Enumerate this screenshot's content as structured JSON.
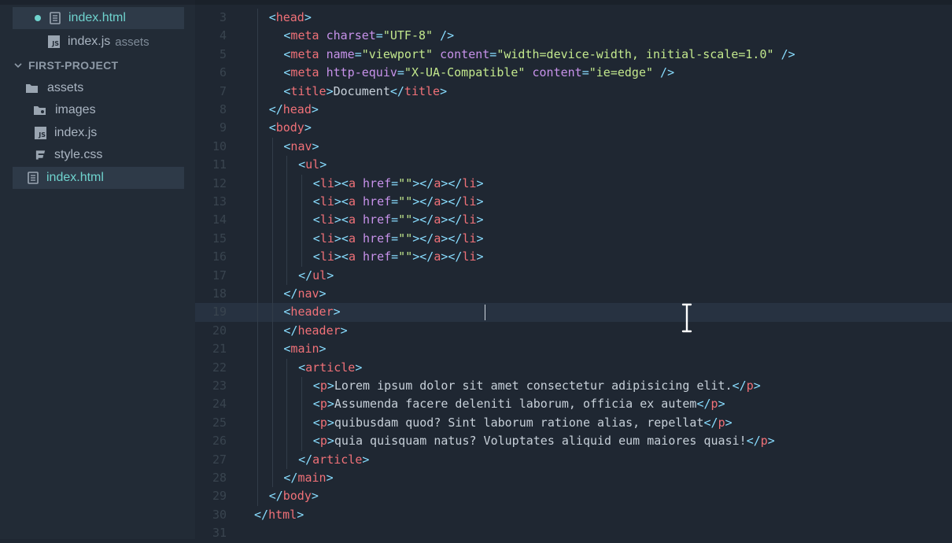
{
  "sidebar": {
    "open_file": {
      "label": "index.html"
    },
    "open_file_2": {
      "label": "index.js",
      "hint": "assets"
    },
    "project": {
      "label": "FIRST-PROJECT"
    },
    "folder": {
      "label": "assets"
    },
    "items": [
      {
        "label": "images"
      },
      {
        "label": "index.js"
      },
      {
        "label": "style.css"
      }
    ],
    "selected_file": {
      "label": "index.html"
    }
  },
  "editor": {
    "current_line": 19,
    "lines": [
      {
        "num": "3",
        "indent": 1,
        "tokens": [
          [
            "br",
            "<"
          ],
          [
            "tag",
            "head"
          ],
          [
            "br",
            ">"
          ]
        ]
      },
      {
        "num": "4",
        "indent": 2,
        "tokens": [
          [
            "br",
            "<"
          ],
          [
            "tag",
            "meta"
          ],
          [
            "txt",
            " "
          ],
          [
            "attr",
            "charset"
          ],
          [
            "op",
            "="
          ],
          [
            "str",
            "\"UTF-8\""
          ],
          [
            "txt",
            " "
          ],
          [
            "br",
            "/>"
          ]
        ]
      },
      {
        "num": "5",
        "indent": 2,
        "tokens": [
          [
            "br",
            "<"
          ],
          [
            "tag",
            "meta"
          ],
          [
            "txt",
            " "
          ],
          [
            "attr",
            "name"
          ],
          [
            "op",
            "="
          ],
          [
            "str",
            "\"viewport\""
          ],
          [
            "txt",
            " "
          ],
          [
            "attr",
            "content"
          ],
          [
            "op",
            "="
          ],
          [
            "str",
            "\"width=device-width, initial-scale=1.0\""
          ],
          [
            "txt",
            " "
          ],
          [
            "br",
            "/>"
          ]
        ]
      },
      {
        "num": "6",
        "indent": 2,
        "tokens": [
          [
            "br",
            "<"
          ],
          [
            "tag",
            "meta"
          ],
          [
            "txt",
            " "
          ],
          [
            "attr",
            "http-equiv"
          ],
          [
            "op",
            "="
          ],
          [
            "str",
            "\"X-UA-Compatible\""
          ],
          [
            "txt",
            " "
          ],
          [
            "attr",
            "content"
          ],
          [
            "op",
            "="
          ],
          [
            "str",
            "\"ie=edge\""
          ],
          [
            "txt",
            " "
          ],
          [
            "br",
            "/>"
          ]
        ]
      },
      {
        "num": "7",
        "indent": 2,
        "tokens": [
          [
            "br",
            "<"
          ],
          [
            "tag",
            "title"
          ],
          [
            "br",
            ">"
          ],
          [
            "txt",
            "Document"
          ],
          [
            "br",
            "</"
          ],
          [
            "tag",
            "title"
          ],
          [
            "br",
            ">"
          ]
        ]
      },
      {
        "num": "8",
        "indent": 1,
        "tokens": [
          [
            "br",
            "</"
          ],
          [
            "tag",
            "head"
          ],
          [
            "br",
            ">"
          ]
        ]
      },
      {
        "num": "9",
        "indent": 1,
        "tokens": [
          [
            "br",
            "<"
          ],
          [
            "tag",
            "body"
          ],
          [
            "br",
            ">"
          ]
        ]
      },
      {
        "num": "10",
        "indent": 2,
        "tokens": [
          [
            "br",
            "<"
          ],
          [
            "tag",
            "nav"
          ],
          [
            "br",
            ">"
          ]
        ]
      },
      {
        "num": "11",
        "indent": 3,
        "tokens": [
          [
            "br",
            "<"
          ],
          [
            "tag",
            "ul"
          ],
          [
            "br",
            ">"
          ]
        ]
      },
      {
        "num": "12",
        "indent": 4,
        "tokens": [
          [
            "br",
            "<"
          ],
          [
            "tag",
            "li"
          ],
          [
            "br",
            "><"
          ],
          [
            "tag",
            "a"
          ],
          [
            "txt",
            " "
          ],
          [
            "attr",
            "href"
          ],
          [
            "op",
            "="
          ],
          [
            "str",
            "\"\""
          ],
          [
            "br",
            "></"
          ],
          [
            "tag",
            "a"
          ],
          [
            "br",
            "></"
          ],
          [
            "tag",
            "li"
          ],
          [
            "br",
            ">"
          ]
        ]
      },
      {
        "num": "13",
        "indent": 4,
        "tokens": [
          [
            "br",
            "<"
          ],
          [
            "tag",
            "li"
          ],
          [
            "br",
            "><"
          ],
          [
            "tag",
            "a"
          ],
          [
            "txt",
            " "
          ],
          [
            "attr",
            "href"
          ],
          [
            "op",
            "="
          ],
          [
            "str",
            "\"\""
          ],
          [
            "br",
            "></"
          ],
          [
            "tag",
            "a"
          ],
          [
            "br",
            "></"
          ],
          [
            "tag",
            "li"
          ],
          [
            "br",
            ">"
          ]
        ]
      },
      {
        "num": "14",
        "indent": 4,
        "tokens": [
          [
            "br",
            "<"
          ],
          [
            "tag",
            "li"
          ],
          [
            "br",
            "><"
          ],
          [
            "tag",
            "a"
          ],
          [
            "txt",
            " "
          ],
          [
            "attr",
            "href"
          ],
          [
            "op",
            "="
          ],
          [
            "str",
            "\"\""
          ],
          [
            "br",
            "></"
          ],
          [
            "tag",
            "a"
          ],
          [
            "br",
            "></"
          ],
          [
            "tag",
            "li"
          ],
          [
            "br",
            ">"
          ]
        ]
      },
      {
        "num": "15",
        "indent": 4,
        "tokens": [
          [
            "br",
            "<"
          ],
          [
            "tag",
            "li"
          ],
          [
            "br",
            "><"
          ],
          [
            "tag",
            "a"
          ],
          [
            "txt",
            " "
          ],
          [
            "attr",
            "href"
          ],
          [
            "op",
            "="
          ],
          [
            "str",
            "\"\""
          ],
          [
            "br",
            "></"
          ],
          [
            "tag",
            "a"
          ],
          [
            "br",
            "></"
          ],
          [
            "tag",
            "li"
          ],
          [
            "br",
            ">"
          ]
        ]
      },
      {
        "num": "16",
        "indent": 4,
        "tokens": [
          [
            "br",
            "<"
          ],
          [
            "tag",
            "li"
          ],
          [
            "br",
            "><"
          ],
          [
            "tag",
            "a"
          ],
          [
            "txt",
            " "
          ],
          [
            "attr",
            "href"
          ],
          [
            "op",
            "="
          ],
          [
            "str",
            "\"\""
          ],
          [
            "br",
            "></"
          ],
          [
            "tag",
            "a"
          ],
          [
            "br",
            "></"
          ],
          [
            "tag",
            "li"
          ],
          [
            "br",
            ">"
          ]
        ]
      },
      {
        "num": "17",
        "indent": 3,
        "tokens": [
          [
            "br",
            "</"
          ],
          [
            "tag",
            "ul"
          ],
          [
            "br",
            ">"
          ]
        ]
      },
      {
        "num": "18",
        "indent": 2,
        "tokens": [
          [
            "br",
            "</"
          ],
          [
            "tag",
            "nav"
          ],
          [
            "br",
            ">"
          ]
        ]
      },
      {
        "num": "19",
        "indent": 2,
        "tokens": [
          [
            "br",
            "<"
          ],
          [
            "tag",
            "header"
          ],
          [
            "br",
            ">"
          ]
        ]
      },
      {
        "num": "20",
        "indent": 2,
        "tokens": [
          [
            "br",
            "</"
          ],
          [
            "tag",
            "header"
          ],
          [
            "br",
            ">"
          ]
        ]
      },
      {
        "num": "21",
        "indent": 2,
        "tokens": [
          [
            "br",
            "<"
          ],
          [
            "tag",
            "main"
          ],
          [
            "br",
            ">"
          ]
        ]
      },
      {
        "num": "22",
        "indent": 3,
        "tokens": [
          [
            "br",
            "<"
          ],
          [
            "tag",
            "article"
          ],
          [
            "br",
            ">"
          ]
        ]
      },
      {
        "num": "23",
        "indent": 4,
        "tokens": [
          [
            "br",
            "<"
          ],
          [
            "tag",
            "p"
          ],
          [
            "br",
            ">"
          ],
          [
            "txt",
            "Lorem ipsum dolor sit amet consectetur adipisicing elit."
          ],
          [
            "br",
            "</"
          ],
          [
            "tag",
            "p"
          ],
          [
            "br",
            ">"
          ]
        ]
      },
      {
        "num": "24",
        "indent": 4,
        "tokens": [
          [
            "br",
            "<"
          ],
          [
            "tag",
            "p"
          ],
          [
            "br",
            ">"
          ],
          [
            "txt",
            "Assumenda facere deleniti laborum, officia ex autem"
          ],
          [
            "br",
            "</"
          ],
          [
            "tag",
            "p"
          ],
          [
            "br",
            ">"
          ]
        ]
      },
      {
        "num": "25",
        "indent": 4,
        "tokens": [
          [
            "br",
            "<"
          ],
          [
            "tag",
            "p"
          ],
          [
            "br",
            ">"
          ],
          [
            "txt",
            "quibusdam quod? Sint laborum ratione alias, repellat"
          ],
          [
            "br",
            "</"
          ],
          [
            "tag",
            "p"
          ],
          [
            "br",
            ">"
          ]
        ]
      },
      {
        "num": "26",
        "indent": 4,
        "tokens": [
          [
            "br",
            "<"
          ],
          [
            "tag",
            "p"
          ],
          [
            "br",
            ">"
          ],
          [
            "txt",
            "quia quisquam natus? Voluptates aliquid eum maiores quasi!"
          ],
          [
            "br",
            "</"
          ],
          [
            "tag",
            "p"
          ],
          [
            "br",
            ">"
          ]
        ]
      },
      {
        "num": "27",
        "indent": 3,
        "tokens": [
          [
            "br",
            "</"
          ],
          [
            "tag",
            "article"
          ],
          [
            "br",
            ">"
          ]
        ]
      },
      {
        "num": "28",
        "indent": 2,
        "tokens": [
          [
            "br",
            "</"
          ],
          [
            "tag",
            "main"
          ],
          [
            "br",
            ">"
          ]
        ]
      },
      {
        "num": "29",
        "indent": 1,
        "tokens": [
          [
            "br",
            "</"
          ],
          [
            "tag",
            "body"
          ],
          [
            "br",
            ">"
          ]
        ]
      },
      {
        "num": "30",
        "indent": 0,
        "tokens": [
          [
            "br",
            "</"
          ],
          [
            "tag",
            "html"
          ],
          [
            "br",
            ">"
          ]
        ]
      },
      {
        "num": "31",
        "indent": 0,
        "tokens": []
      }
    ]
  }
}
